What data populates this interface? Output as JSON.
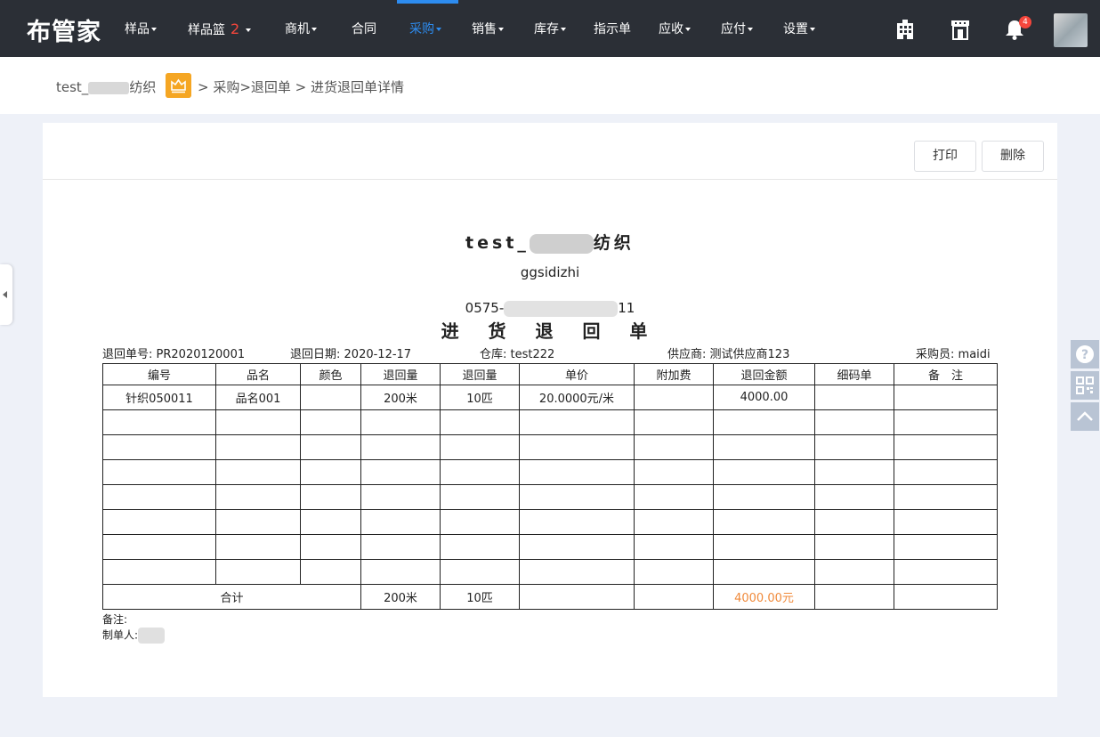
{
  "app": {
    "logo": "布管家"
  },
  "nav": {
    "items": [
      {
        "label": "样品",
        "caret": true
      },
      {
        "label": "样品篮",
        "badge": "2",
        "caret": true
      },
      {
        "label": "商机",
        "caret": true
      },
      {
        "label": "合同",
        "caret": false
      },
      {
        "label": "采购",
        "caret": true,
        "active": true
      },
      {
        "label": "销售",
        "caret": true
      },
      {
        "label": "库存",
        "caret": true
      },
      {
        "label": "指示单",
        "caret": false
      },
      {
        "label": "应收",
        "caret": true
      },
      {
        "label": "应付",
        "caret": true
      },
      {
        "label": "设置",
        "caret": true
      }
    ],
    "notification_count": "4",
    "icons": [
      "building-icon",
      "store-icon",
      "bell-icon",
      "avatar"
    ]
  },
  "breadcrumb": {
    "company_prefix": "test_",
    "company_suffix": "纺织",
    "path": "> 采购>退回单 > 进货退回单详情"
  },
  "toolbar": {
    "print_label": "打印",
    "delete_label": "删除"
  },
  "document": {
    "company_prefix": "test_",
    "company_suffix": "纺织",
    "address": "ggsidizhi",
    "phone_prefix": "0575-",
    "phone_suffix": "11",
    "title": "进 货 退 回 单",
    "meta": {
      "return_no_label": "退回单号:",
      "return_no": "PR2020120001",
      "return_date_label": "退回日期:",
      "return_date": "2020-12-17",
      "warehouse_label": "仓库:",
      "warehouse": "test222",
      "supplier_label": "供应商:",
      "supplier": "测试供应商123",
      "buyer_label": "采购员:",
      "buyer": "maidi"
    },
    "table": {
      "headers": [
        "编号",
        "品名",
        "颜色",
        "退回量",
        "退回量",
        "单价",
        "附加费",
        "退回金额",
        "细码单",
        "备　注"
      ],
      "rows": [
        [
          "针织050011",
          "品名001",
          "",
          "200米",
          "10匹",
          "20.0000元/米",
          "",
          "4000.00",
          "",
          ""
        ]
      ],
      "empty_rows": 7,
      "total": {
        "label": "合计",
        "qty1": "200米",
        "qty2": "10匹",
        "amount": "4000.00元"
      }
    },
    "remark_label": "备注:",
    "creator_label": "制单人:"
  },
  "colors": {
    "nav_bg": "#2b2f36",
    "active": "#2d8cf0",
    "badge": "#f5463c",
    "total_amount": "#f08a3b",
    "page_bg": "#eef1f8"
  }
}
